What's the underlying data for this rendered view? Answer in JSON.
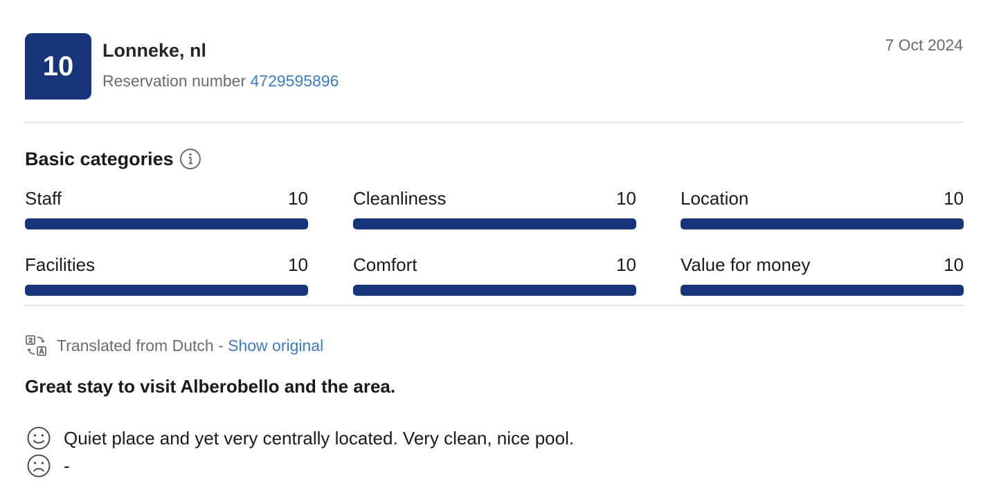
{
  "review": {
    "score": "10",
    "reviewer": "Lonneke, nl",
    "reservation_label": "Reservation number",
    "reservation_number": "4729595896",
    "date": "7 Oct 2024"
  },
  "categories": {
    "title": "Basic categories",
    "items": [
      {
        "label": "Staff",
        "score": "10",
        "fraction": 1.0
      },
      {
        "label": "Cleanliness",
        "score": "10",
        "fraction": 1.0
      },
      {
        "label": "Location",
        "score": "10",
        "fraction": 1.0
      },
      {
        "label": "Facilities",
        "score": "10",
        "fraction": 1.0
      },
      {
        "label": "Comfort",
        "score": "10",
        "fraction": 1.0
      },
      {
        "label": "Value for money",
        "score": "10",
        "fraction": 1.0
      }
    ]
  },
  "translation": {
    "text": "Translated from Dutch -",
    "show_original": "Show original"
  },
  "content": {
    "title": "Great stay to visit Alberobello and the area.",
    "positive": "Quiet place and yet very centrally located. Very clean, nice pool.",
    "negative": "-"
  },
  "colors": {
    "accent": "#163479",
    "link": "#3c7ac2"
  }
}
